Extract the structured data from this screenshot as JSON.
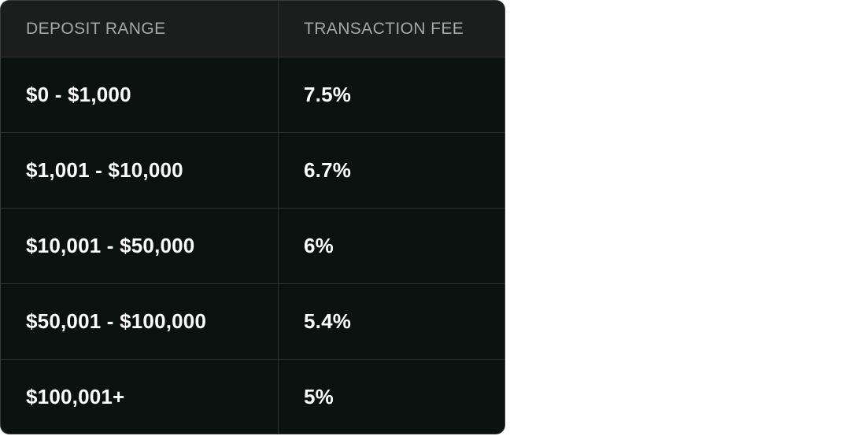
{
  "table": {
    "headers": {
      "deposit_range": "DEPOSIT RANGE",
      "transaction_fee": "TRANSACTION FEE"
    },
    "rows": [
      {
        "range": "$0 - $1,000",
        "fee": "7.5%"
      },
      {
        "range": "$1,001 - $10,000",
        "fee": "6.7%"
      },
      {
        "range": "$10,001 - $50,000",
        "fee": "6%"
      },
      {
        "range": "$50,001 - $100,000",
        "fee": "5.4%"
      },
      {
        "range": "$100,001+",
        "fee": "5%"
      }
    ]
  },
  "colors": {
    "table_background": "#0a110f",
    "header_background": "#1c1e1e",
    "header_text": "#a4a8a7",
    "cell_text": "#ffffff",
    "border": "#2f3231",
    "page_background": "#ffffff"
  }
}
